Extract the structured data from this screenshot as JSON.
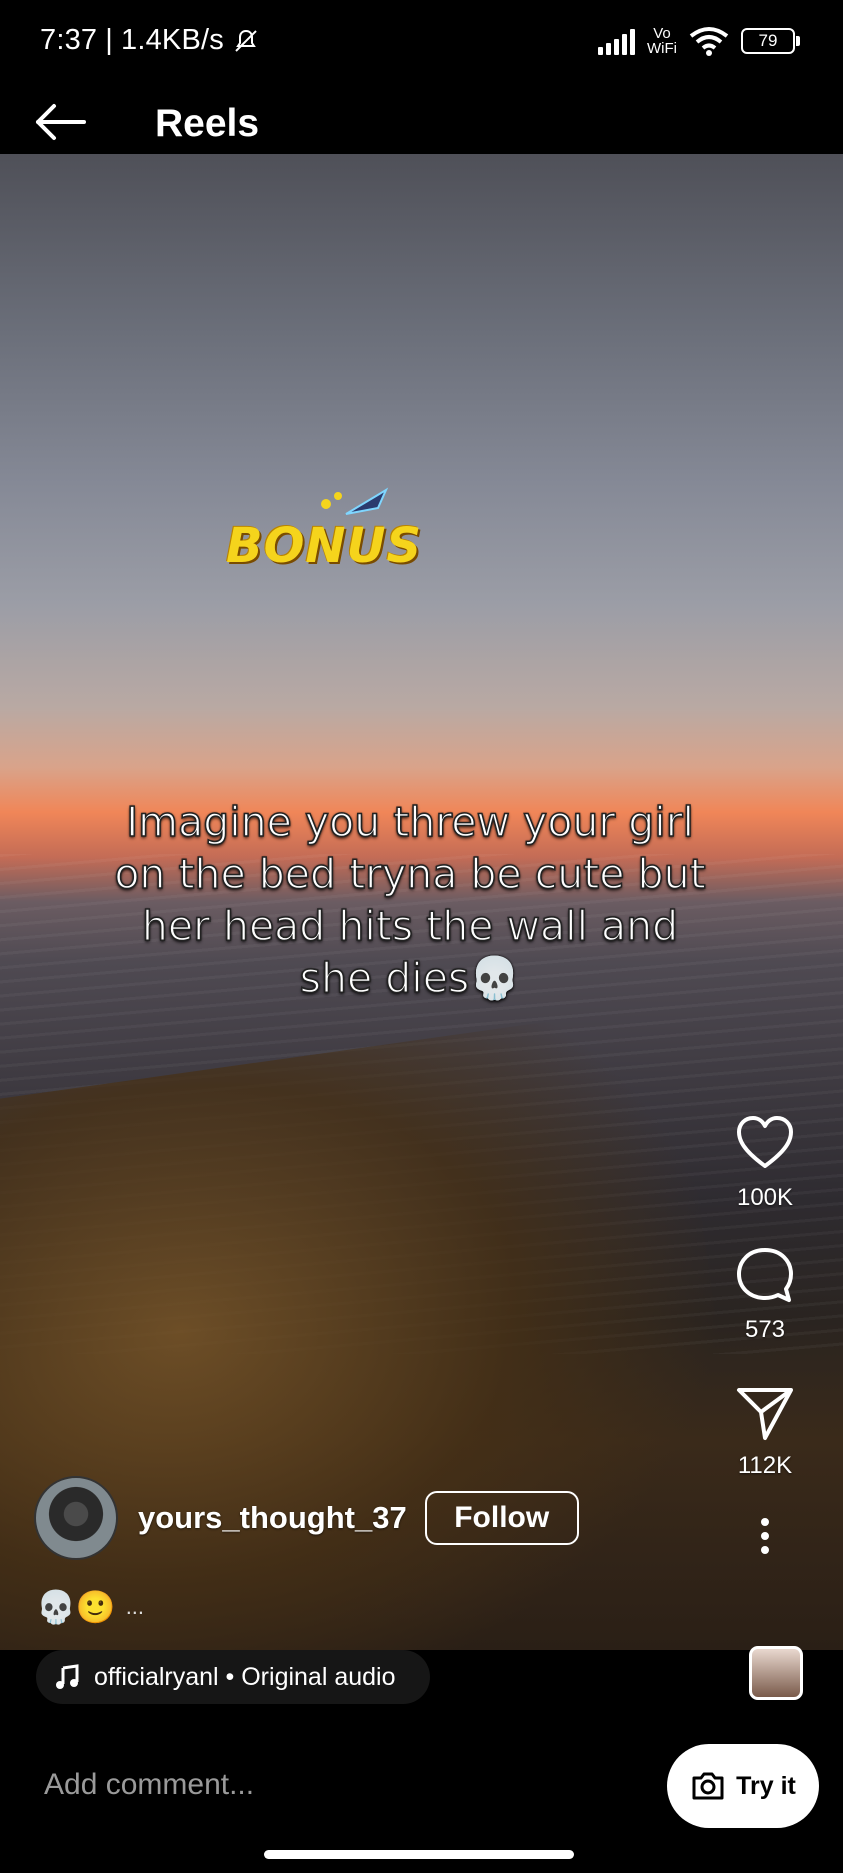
{
  "status_bar": {
    "time": "7:37",
    "separator": "|",
    "net_speed": "1.4KB/s",
    "vowifi_top": "Vo",
    "vowifi_bottom": "WiFi",
    "battery": "79"
  },
  "header": {
    "title": "Reels"
  },
  "video": {
    "badge_text": "BONUS",
    "overlay_text": "Imagine you threw your girl on the bed tryna be cute but her head hits the wall and she dies💀"
  },
  "actions": {
    "likes": "100K",
    "comments": "573",
    "shares": "112K"
  },
  "author": {
    "username": "yours_thought_37",
    "follow_label": "Follow"
  },
  "caption": {
    "emojis": "💀🙂",
    "more": "..."
  },
  "audio": {
    "label": "officialryanl • Original audio"
  },
  "comment_bar": {
    "placeholder": "Add comment...",
    "try_label": "Try it"
  }
}
